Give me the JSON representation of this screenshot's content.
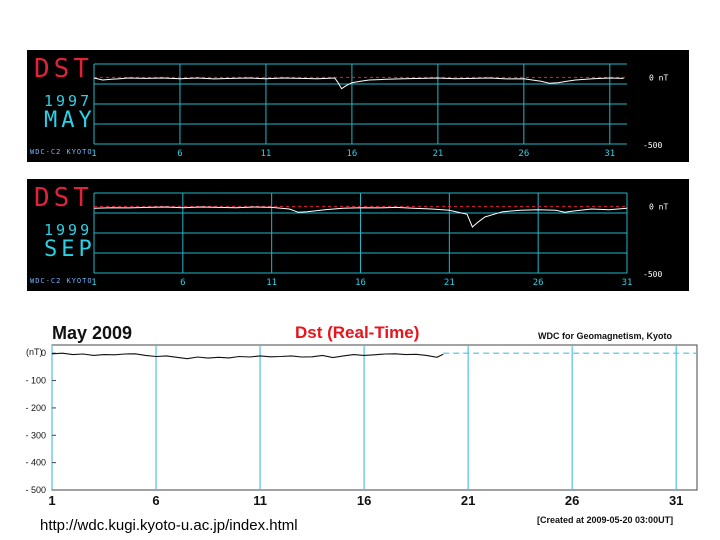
{
  "chart_data": [
    {
      "type": "line",
      "panel": "1997",
      "label": "DST",
      "year": "1997",
      "month": "MAY",
      "caption": "WDC-C2 KYOTO",
      "x_ticks": [
        "1",
        "6",
        "11",
        "16",
        "21",
        "26",
        "31"
      ],
      "y_ticks": [
        "0 nT",
        "-500"
      ],
      "xlim": [
        1,
        32
      ],
      "ylim": [
        -500,
        100
      ],
      "grid": true,
      "colors": {
        "background": "#000000",
        "grid": "#1fb7c9",
        "line": "#ffffff",
        "zero": "#e0223a",
        "label_red": "#e0223a",
        "label_cyan": "#2ad2e6"
      },
      "series": [
        {
          "x": [
            1,
            1.5,
            2,
            2.5,
            3,
            4,
            5,
            6,
            7,
            8,
            9,
            10,
            11,
            12,
            13,
            14,
            15,
            15.2,
            15.4,
            15.7,
            16,
            16.5,
            17,
            18,
            19,
            20,
            21,
            22,
            23,
            24,
            25,
            26,
            27,
            27.5,
            28,
            28.5,
            29,
            30,
            31,
            31.8
          ],
          "y": [
            -5,
            -20,
            -15,
            -10,
            -5,
            -8,
            -5,
            -10,
            -5,
            -12,
            -8,
            -5,
            -10,
            -5,
            -8,
            -10,
            -5,
            -40,
            -85,
            -60,
            -40,
            -30,
            -20,
            -15,
            -10,
            -8,
            -5,
            -10,
            -8,
            -5,
            -12,
            -10,
            -30,
            -45,
            -40,
            -30,
            -20,
            -10,
            -5,
            -8
          ]
        }
      ]
    },
    {
      "type": "line",
      "panel": "1999",
      "label": "DST",
      "year": "1999",
      "month": "SEP",
      "caption": "WDC-C2 KYOTO",
      "x_ticks": [
        "1",
        "6",
        "11",
        "16",
        "21",
        "26",
        "31"
      ],
      "y_ticks": [
        "0 nT",
        "-500"
      ],
      "xlim": [
        1,
        31
      ],
      "ylim": [
        -500,
        100
      ],
      "grid": true,
      "colors": {
        "background": "#000000",
        "grid": "#1fb7c9",
        "line": "#ffffff",
        "zero": "#e0223a",
        "label_red": "#e0223a",
        "label_cyan": "#2ad2e6"
      },
      "series": [
        {
          "x": [
            1,
            2,
            3,
            4,
            5,
            6,
            7,
            8,
            9,
            10,
            11,
            12,
            12.5,
            13,
            14,
            15,
            16,
            17,
            18,
            19,
            20,
            21,
            22,
            22.3,
            22.6,
            23,
            23.5,
            24,
            25,
            26,
            27,
            27.5,
            28,
            29,
            30,
            31
          ],
          "y": [
            -15,
            -10,
            -12,
            -8,
            -5,
            -10,
            -5,
            -8,
            -10,
            -5,
            -8,
            -20,
            -45,
            -40,
            -25,
            -15,
            -10,
            -12,
            -8,
            -15,
            -20,
            -30,
            -60,
            -155,
            -120,
            -80,
            -60,
            -40,
            -30,
            -25,
            -30,
            -45,
            -35,
            -20,
            -25,
            -15
          ]
        }
      ]
    },
    {
      "type": "line",
      "panel": "2009",
      "title": "Dst (Real-Time)",
      "month": "May  2009",
      "source": "WDC for Geomagnetism, Kyoto",
      "created": "[Created at 2009-05-20 03:00UT]",
      "ylabel": "(nT)",
      "x_ticks": [
        "1",
        "6",
        "11",
        "16",
        "21",
        "26",
        "31"
      ],
      "y_ticks": [
        "0",
        "- 100",
        "- 200",
        "- 300",
        "- 400",
        "- 500"
      ],
      "xlim": [
        1,
        32
      ],
      "ylim": [
        -500,
        30
      ],
      "grid": true,
      "colors": {
        "grid": "#4fc3e0",
        "line": "#111111",
        "zero_dashed": "#4fc3e0",
        "title": "#e8141c"
      },
      "series": [
        {
          "x": [
            1,
            1.5,
            2,
            2.5,
            3,
            3.5,
            4,
            4.5,
            5,
            5.5,
            6,
            6.5,
            7,
            7.5,
            8,
            8.5,
            9,
            9.5,
            10,
            10.5,
            11,
            11.5,
            12,
            12.5,
            13,
            13.5,
            14,
            14.5,
            15,
            15.5,
            16,
            16.5,
            17,
            17.5,
            18,
            18.5,
            19,
            19.5,
            19.8
          ],
          "y": [
            -2,
            0,
            -5,
            -3,
            -8,
            -5,
            -6,
            -3,
            -2,
            -8,
            -12,
            -10,
            -15,
            -20,
            -14,
            -18,
            -15,
            -17,
            -12,
            -14,
            -10,
            -13,
            -12,
            -10,
            -14,
            -13,
            -8,
            -16,
            -10,
            -5,
            -8,
            -6,
            -3,
            -2,
            -5,
            -4,
            -8,
            -15,
            -4
          ]
        }
      ]
    }
  ],
  "footer": {
    "url": "http://wdc.kugi.kyoto-u.ac.jp/index.html"
  }
}
